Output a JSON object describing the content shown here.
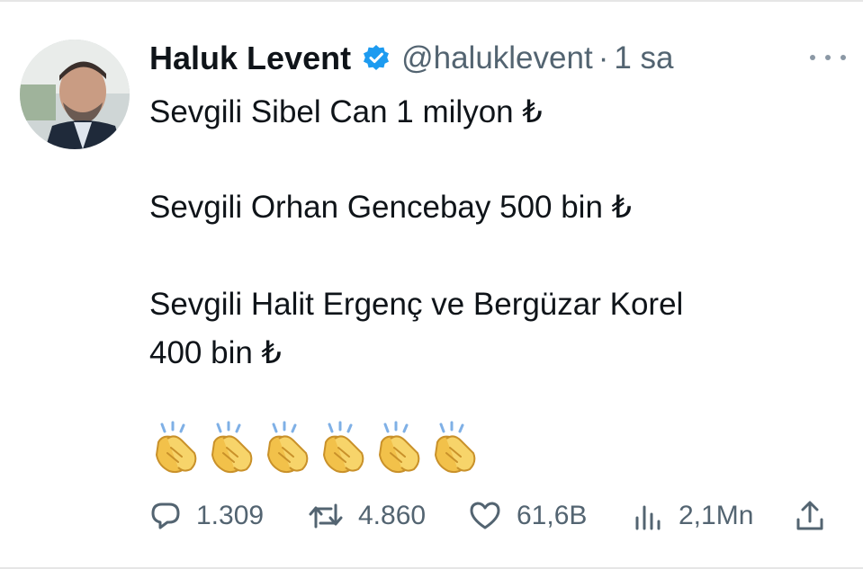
{
  "tweet": {
    "author_name": "Haluk Levent",
    "handle": "@haluklevent",
    "separator": "·",
    "time": "1 sa",
    "lines": [
      "Sevgili Sibel Can 1 milyon ₺",
      "Sevgili Orhan Gencebay 500 bin ₺",
      "Sevgili Halit Ergenç ve Bergüzar Korel",
      "400 bin ₺"
    ],
    "emoji": "clapping-hands",
    "emoji_count": 6
  },
  "actions": {
    "replies": "1.309",
    "retweets": "4.860",
    "likes": "61,6B",
    "views": "2,1Mn"
  },
  "colors": {
    "text": "#0f1419",
    "secondary": "#536471",
    "verified": "#1d9bf0",
    "background": "#ffffff"
  }
}
